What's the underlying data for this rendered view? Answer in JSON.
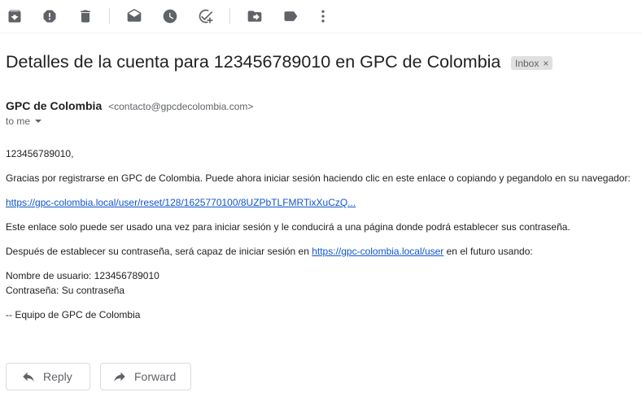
{
  "toolbar": {
    "icons": [
      "archive-icon",
      "report-spam-icon",
      "delete-icon",
      "mark-unread-icon",
      "snooze-icon",
      "add-task-icon",
      "move-to-icon",
      "labels-icon",
      "more-icon"
    ]
  },
  "email": {
    "subject": "Detalles de la cuenta para 123456789010 en GPC de Colombia",
    "label": "Inbox",
    "label_close": "×",
    "sender_name": "GPC de Colombia",
    "sender_email": "<contacto@gpcdecolombia.com>",
    "recipient": "to me",
    "greeting": "123456789010,",
    "line1": "Gracias por registrarse en GPC de Colombia. Puede ahora iniciar sesión haciendo clic en este enlace o copiando y pegandolo en su navegador:",
    "reset_link": "https://gpc-colombia.local/user/reset/128/1625770100/8UZPbTLFMRTixXuCzQ...",
    "line2": "Este enlace solo puede ser usado una vez para iniciar sesión y le conducirá a una página donde podrá establecer sus contraseña.",
    "line3_before": "Después de establecer su contraseña, será capaz de iniciar sesión en ",
    "user_link": "https://gpc-colombia.local/user",
    "line3_after": " en el futuro usando:",
    "username_line": "Nombre de usuario: 123456789010",
    "password_line": "Contraseña: Su contraseña",
    "signature": "-- Equipo de GPC de Colombia"
  },
  "actions": {
    "reply": "Reply",
    "forward": "Forward"
  }
}
